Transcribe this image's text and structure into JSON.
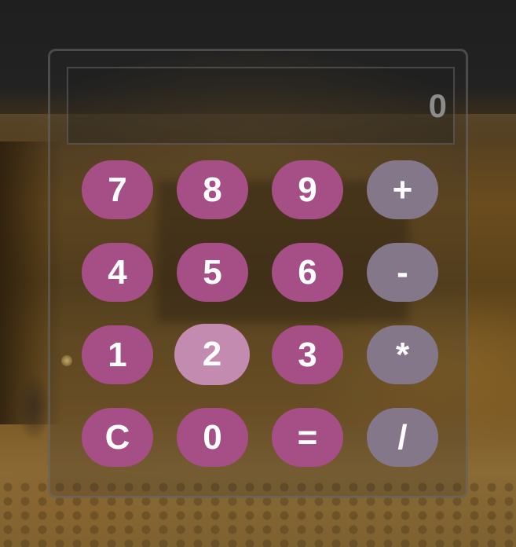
{
  "display": {
    "value": "0"
  },
  "keypad": {
    "rows": [
      [
        "7",
        "8",
        "9",
        "+"
      ],
      [
        "4",
        "5",
        "6",
        "-"
      ],
      [
        "1",
        "2",
        "3",
        "*"
      ],
      [
        "C",
        "0",
        "=",
        "/"
      ]
    ]
  },
  "colors": {
    "number_key": "#a64f86",
    "operator_key": "#85778a",
    "hovered_key": "#c48bb0",
    "display_text": "#8c8c8c"
  }
}
